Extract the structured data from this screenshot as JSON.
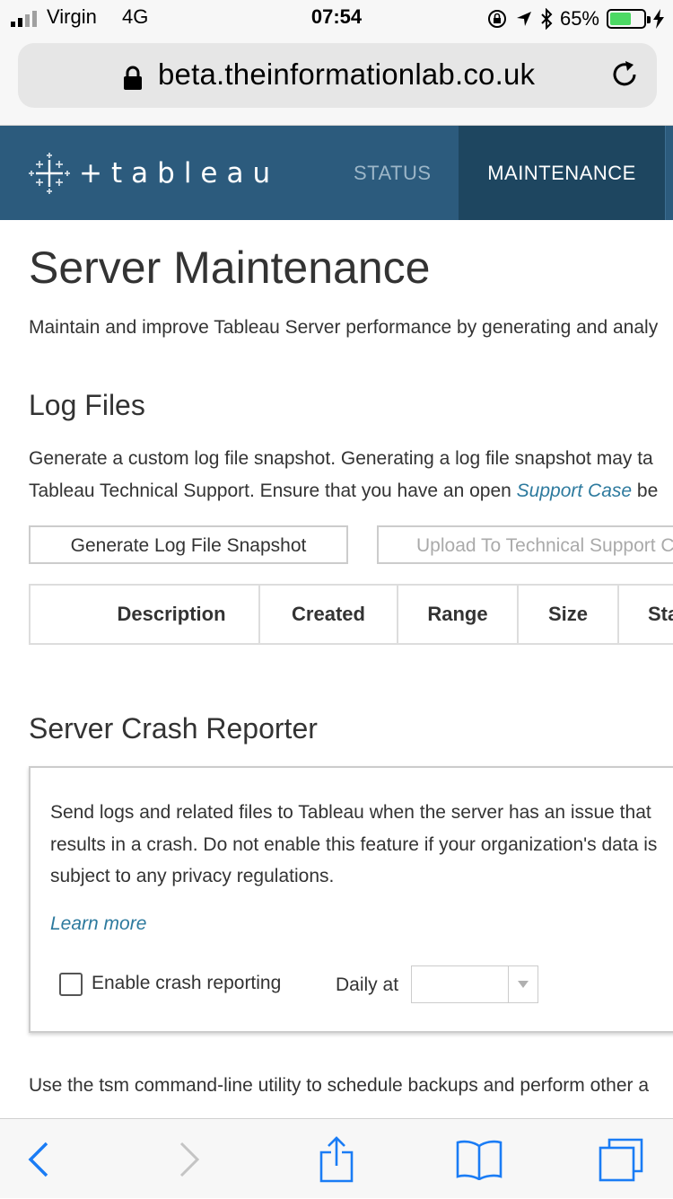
{
  "status_bar": {
    "carrier": "Virgin",
    "network": "4G",
    "time": "07:54",
    "battery_percent": "65%",
    "battery_level": 0.65,
    "battery_color": "#4cd964"
  },
  "browser": {
    "url": "beta.theinformationlab.co.uk",
    "icons": [
      "lock-icon",
      "reload-icon",
      "back-icon",
      "forward-icon",
      "share-icon",
      "bookmarks-icon",
      "tabs-icon"
    ]
  },
  "header": {
    "brand": "+ableau",
    "brand_prefix": "+",
    "brand_word": "ableau",
    "nav": [
      {
        "label": "STATUS",
        "active": false
      },
      {
        "label": "MAINTENANCE",
        "active": true
      }
    ],
    "colors": {
      "header_bg": "#2c5b7d",
      "active_tab_bg": "#1e4660"
    }
  },
  "page": {
    "title": "Server Maintenance",
    "intro": "Maintain and improve Tableau Server performance by generating and analy"
  },
  "log_files": {
    "title": "Log Files",
    "line1": "Generate a custom log file snapshot. Generating a log file snapshot may ta",
    "line2_pre": "Tableau Technical Support. Ensure that you have an open ",
    "line2_link": "Support Case",
    "line2_post": " be",
    "generate_button": "Generate Log File Snapshot",
    "upload_button": "Upload To Technical Support C",
    "table_headers": [
      "Description",
      "Created",
      "Range",
      "Size",
      "Sta"
    ]
  },
  "crash_reporter": {
    "title": "Server Crash Reporter",
    "line1": "Send logs and related files to Tableau when the server has an issue that",
    "line2": "results in a crash. Do not enable this feature if your organization's data is",
    "line3": "subject to any privacy regulations.",
    "learn_more": "Learn more",
    "checkbox_label": "Enable crash reporting",
    "checkbox_checked": false,
    "daily_label": "Daily at",
    "daily_value": ""
  },
  "footer_text": "Use the tsm command-line utility to schedule backups and perform other a",
  "colors": {
    "link": "#2d7a9e",
    "icon_blue": "#1a7cf5"
  }
}
